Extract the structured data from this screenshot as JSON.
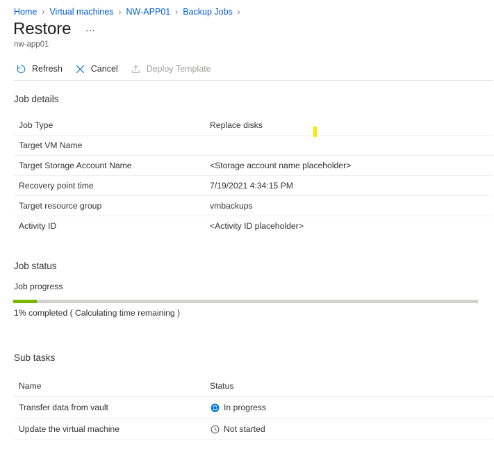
{
  "breadcrumb": {
    "separator": "›",
    "items": [
      {
        "label": "Home"
      },
      {
        "label": "Virtual machines"
      },
      {
        "label": "NW-APP01"
      },
      {
        "label": "Backup Jobs"
      }
    ]
  },
  "header": {
    "title": "Restore",
    "ellipsis": "…",
    "subtitle": "nw-app01"
  },
  "toolbar": {
    "refresh_label": "Refresh",
    "cancel_label": "Cancel",
    "deploy_label": "Deploy Template"
  },
  "job_details": {
    "heading": "Job details",
    "rows": [
      {
        "label": "Job Type",
        "value": "Replace disks"
      },
      {
        "label": "Target VM Name",
        "value": ""
      },
      {
        "label": "Target Storage Account Name",
        "value": "<Storage account name placeholder>"
      },
      {
        "label": "Recovery point time",
        "value": "7/19/2021 4:34:15 PM"
      },
      {
        "label": "Target resource group",
        "value": "vmbackups"
      },
      {
        "label": "Activity ID",
        "value": "<Activity ID placeholder>"
      }
    ]
  },
  "job_status": {
    "heading": "Job status",
    "progress_label": "Job progress",
    "progress_percent": 1,
    "progress_caption": "1% completed ( Calculating time remaining )",
    "progress_fill_color": "#7cb700",
    "progress_track_color": "#d2d0ce"
  },
  "sub_tasks": {
    "heading": "Sub tasks",
    "columns": [
      "Name",
      "Status"
    ],
    "rows": [
      {
        "name": "Transfer data from vault",
        "status": "In progress",
        "status_icon": "sync-in-progress-icon"
      },
      {
        "name": "Update the virtual machine",
        "status": "Not started",
        "status_icon": "clock-not-started-icon"
      }
    ]
  },
  "annotation": {
    "marker_color": "#ffe600"
  },
  "theme": {
    "link_color": "#015cda",
    "text_color": "#323130",
    "divider_color": "#e1dfdd"
  }
}
